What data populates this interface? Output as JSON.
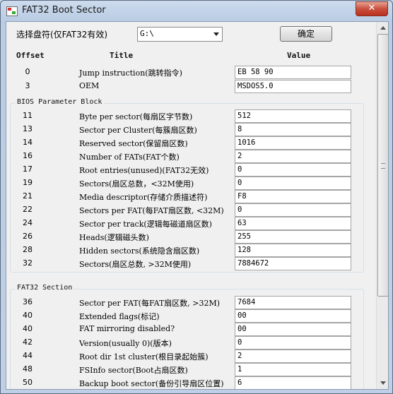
{
  "window": {
    "title": "FAT32 Boot Sector",
    "close_glyph": "✕"
  },
  "top": {
    "drive_label": "选择盘符(仅FAT32有效)",
    "drive_value": "G:\\",
    "ok_label": "确定"
  },
  "headers": {
    "offset": "Offset",
    "title": "Title",
    "value": "Value"
  },
  "rows_top": [
    {
      "offset": "0",
      "title": "Jump instruction(跳转指令)",
      "value": "EB 58 90"
    },
    {
      "offset": "3",
      "title": "OEM",
      "value": "MSDOS5.0"
    }
  ],
  "bpb": {
    "group_title": "BIOS Parameter Block",
    "rows": [
      {
        "offset": "11",
        "title": "Byte per sector(每扇区字节数)",
        "value": "512"
      },
      {
        "offset": "13",
        "title": "Sector per Cluster(每簇扇区数)",
        "value": "8"
      },
      {
        "offset": "14",
        "title": "Reserved sector(保留扇区数)",
        "value": "1016"
      },
      {
        "offset": "16",
        "title": "Number of FATs(FAT个数)",
        "value": "2"
      },
      {
        "offset": "17",
        "title": "Root entries(unused)(FAT32无效)",
        "value": "0"
      },
      {
        "offset": "19",
        "title": "Sectors(扇区总数，<32M使用)",
        "value": "0"
      },
      {
        "offset": "21",
        "title": "Media descriptor(存储介质描述符)",
        "value": "F8"
      },
      {
        "offset": "22",
        "title": "Sectors per FAT(每FAT扇区数, <32M)",
        "value": "0"
      },
      {
        "offset": "24",
        "title": "Sector per track(逻辑每磁道扇区数)",
        "value": "63"
      },
      {
        "offset": "26",
        "title": "Heads(逻辑磁头数)",
        "value": "255"
      },
      {
        "offset": "28",
        "title": "Hidden sectors(系统隐含扇区数)",
        "value": "128"
      },
      {
        "offset": "32",
        "title": "Sectors(扇区总数, >32M使用)",
        "value": "7884672"
      }
    ]
  },
  "fat32": {
    "group_title": "FAT32 Section",
    "rows": [
      {
        "offset": "36",
        "title": "Sector per FAT(每FAT扇区数, >32M)",
        "value": "7684"
      },
      {
        "offset": "40",
        "title": "Extended flags(标记)",
        "value": "00"
      },
      {
        "offset": "40",
        "title": "FAT mirroring disabled?",
        "value": "00"
      },
      {
        "offset": "42",
        "title": "Version(usually 0)(版本)",
        "value": "0"
      },
      {
        "offset": "44",
        "title": "Root dir 1st cluster(根目录起始簇)",
        "value": "2"
      },
      {
        "offset": "48",
        "title": "FSInfo sector(Boot占扇区数)",
        "value": "1"
      },
      {
        "offset": "50",
        "title": "Backup boot sector(备份引导扇区位置)",
        "value": "6"
      }
    ]
  }
}
